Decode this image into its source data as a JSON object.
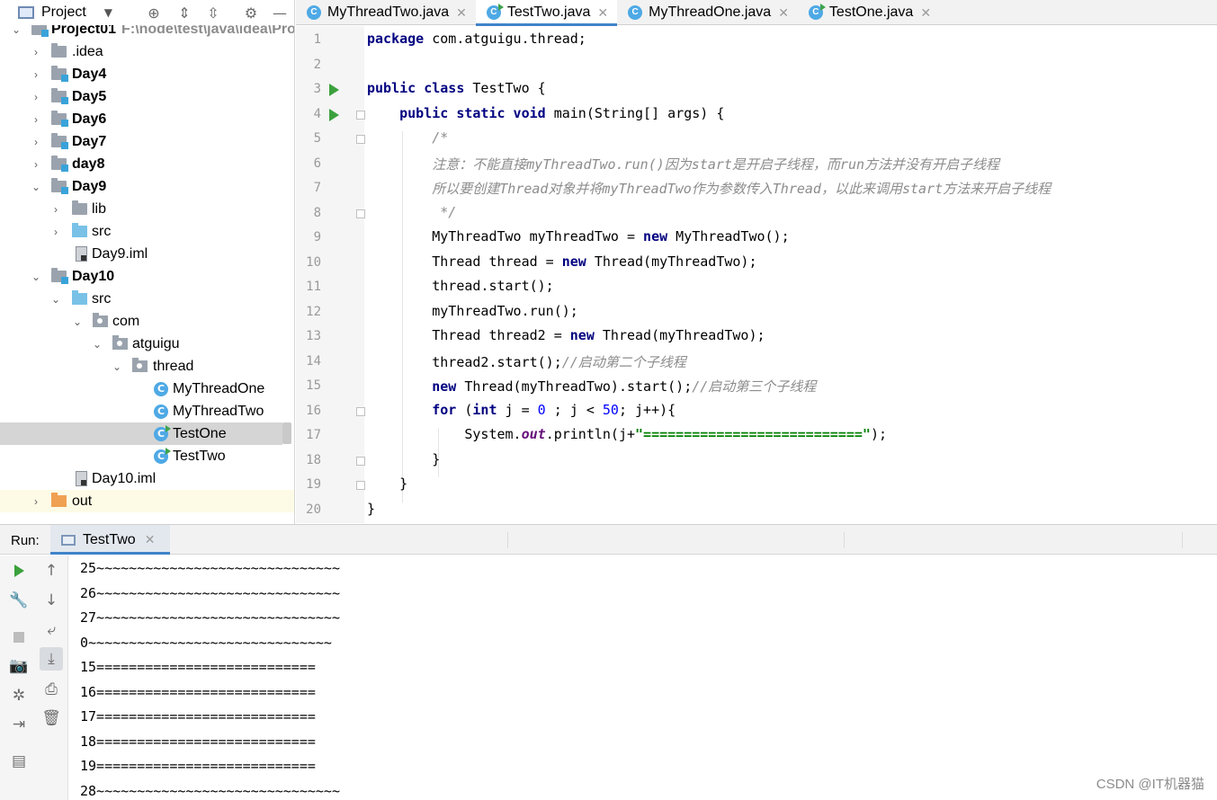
{
  "project_panel": {
    "title": "Project",
    "root_label": "Project01",
    "root_path": "F:\\node\\test\\java\\idea\\Pro",
    "items": [
      {
        "label": ".idea",
        "bold": false
      },
      {
        "label": "Day4",
        "bold": true
      },
      {
        "label": "Day5",
        "bold": true
      },
      {
        "label": "Day6",
        "bold": true
      },
      {
        "label": "Day7",
        "bold": true
      },
      {
        "label": "day8",
        "bold": true
      },
      {
        "label": "Day9",
        "bold": true
      },
      {
        "label": "lib",
        "bold": false
      },
      {
        "label": "src",
        "bold": false
      },
      {
        "label": "Day9.iml",
        "bold": false
      },
      {
        "label": "Day10",
        "bold": true
      },
      {
        "label": "src",
        "bold": false
      },
      {
        "label": "com",
        "bold": false
      },
      {
        "label": "atguigu",
        "bold": false
      },
      {
        "label": "thread",
        "bold": false
      },
      {
        "label": "MyThreadOne",
        "bold": false
      },
      {
        "label": "MyThreadTwo",
        "bold": false
      },
      {
        "label": "TestOne",
        "bold": false
      },
      {
        "label": "TestTwo",
        "bold": false
      },
      {
        "label": "Day10.iml",
        "bold": false
      },
      {
        "label": "out",
        "bold": false
      }
    ],
    "selected": "TestOne"
  },
  "editor_tabs": [
    {
      "label": "MyThreadTwo.java",
      "active": false
    },
    {
      "label": "TestTwo.java",
      "active": true
    },
    {
      "label": "MyThreadOne.java",
      "active": false
    },
    {
      "label": "TestOne.java",
      "active": false
    }
  ],
  "editor": {
    "line_numbers": [
      "1",
      "2",
      "3",
      "4",
      "5",
      "6",
      "7",
      "8",
      "9",
      "10",
      "11",
      "12",
      "13",
      "14",
      "15",
      "16",
      "17",
      "18",
      "19",
      "20"
    ],
    "lines": [
      {
        "no": 1,
        "tokens": [
          {
            "t": "package",
            "c": "kw"
          },
          {
            "t": " com.atguigu.thread;",
            "c": ""
          }
        ]
      },
      {
        "no": 2,
        "tokens": []
      },
      {
        "no": 3,
        "tokens": [
          {
            "t": "public class",
            "c": "kw"
          },
          {
            "t": " TestTwo {",
            "c": ""
          }
        ]
      },
      {
        "no": 4,
        "tokens": [
          {
            "t": "    ",
            "c": ""
          },
          {
            "t": "public static void",
            "c": "kw"
          },
          {
            "t": " main(String[] args) {",
            "c": ""
          }
        ]
      },
      {
        "no": 5,
        "tokens": [
          {
            "t": "        /*",
            "c": "cm"
          }
        ]
      },
      {
        "no": 6,
        "tokens": [
          {
            "t": "        注意：不能直接myThreadTwo.run()因为start是开启子线程，而run方法并没有开启子线程",
            "c": "cm"
          }
        ]
      },
      {
        "no": 7,
        "tokens": [
          {
            "t": "        所以要创建Thread对象并将myThreadTwo作为参数传入Thread，以此来调用start方法来开启子线程",
            "c": "cm"
          }
        ]
      },
      {
        "no": 8,
        "tokens": [
          {
            "t": "         */",
            "c": "cm"
          }
        ]
      },
      {
        "no": 9,
        "tokens": [
          {
            "t": "        MyThreadTwo myThreadTwo = ",
            "c": ""
          },
          {
            "t": "new",
            "c": "kw"
          },
          {
            "t": " MyThreadTwo();",
            "c": ""
          }
        ]
      },
      {
        "no": 10,
        "tokens": [
          {
            "t": "        Thread thread = ",
            "c": ""
          },
          {
            "t": "new",
            "c": "kw"
          },
          {
            "t": " Thread(myThreadTwo);",
            "c": ""
          }
        ]
      },
      {
        "no": 11,
        "tokens": [
          {
            "t": "        thread.start();",
            "c": ""
          }
        ]
      },
      {
        "no": 12,
        "tokens": [
          {
            "t": "        myThreadTwo.run();",
            "c": ""
          }
        ]
      },
      {
        "no": 13,
        "tokens": [
          {
            "t": "        Thread thread2 = ",
            "c": ""
          },
          {
            "t": "new",
            "c": "kw"
          },
          {
            "t": " Thread(myThreadTwo);",
            "c": ""
          }
        ]
      },
      {
        "no": 14,
        "tokens": [
          {
            "t": "        thread2.start();",
            "c": ""
          },
          {
            "t": "//启动第二个子线程",
            "c": "cm"
          }
        ]
      },
      {
        "no": 15,
        "tokens": [
          {
            "t": "        ",
            "c": ""
          },
          {
            "t": "new",
            "c": "kw"
          },
          {
            "t": " Thread(myThreadTwo).start();",
            "c": ""
          },
          {
            "t": "//启动第三个子线程",
            "c": "cm"
          }
        ]
      },
      {
        "no": 16,
        "tokens": [
          {
            "t": "        ",
            "c": ""
          },
          {
            "t": "for",
            "c": "kw"
          },
          {
            "t": " (",
            "c": ""
          },
          {
            "t": "int",
            "c": "kw"
          },
          {
            "t": " j = ",
            "c": ""
          },
          {
            "t": "0",
            "c": "num"
          },
          {
            "t": " ; j < ",
            "c": ""
          },
          {
            "t": "50",
            "c": "num"
          },
          {
            "t": "; j++){",
            "c": ""
          }
        ]
      },
      {
        "no": 17,
        "tokens": [
          {
            "t": "            System.",
            "c": ""
          },
          {
            "t": "out",
            "c": "st"
          },
          {
            "t": ".println(j+",
            "c": ""
          },
          {
            "t": "\"===========================\"",
            "c": "str"
          },
          {
            "t": ");",
            "c": ""
          }
        ]
      },
      {
        "no": 18,
        "tokens": [
          {
            "t": "        }",
            "c": ""
          }
        ]
      },
      {
        "no": 19,
        "tokens": [
          {
            "t": "    }",
            "c": ""
          }
        ]
      },
      {
        "no": 20,
        "tokens": [
          {
            "t": "}",
            "c": ""
          }
        ]
      }
    ]
  },
  "run_panel": {
    "label": "Run:",
    "tab_label": "TestTwo",
    "console_lines": [
      "25~~~~~~~~~~~~~~~~~~~~~~~~~~~~~~",
      "26~~~~~~~~~~~~~~~~~~~~~~~~~~~~~~",
      "27~~~~~~~~~~~~~~~~~~~~~~~~~~~~~~",
      "0~~~~~~~~~~~~~~~~~~~~~~~~~~~~~~",
      "15===========================",
      "16===========================",
      "17===========================",
      "18===========================",
      "19===========================",
      "28~~~~~~~~~~~~~~~~~~~~~~~~~~~~~~"
    ]
  },
  "watermark": "CSDN @IT机器猫",
  "colors": {
    "keyword": "#000080",
    "comment": "#8c8c8c",
    "string": "#008000",
    "number": "#0000ff",
    "accent": "#4083c9",
    "run_green": "#3ba13d"
  }
}
